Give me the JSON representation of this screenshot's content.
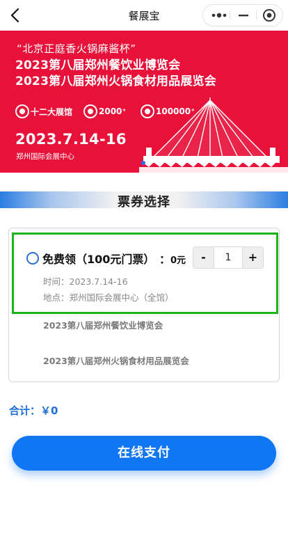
{
  "navbar": {
    "title": "餐展宝"
  },
  "banner": {
    "line1": "“北京正庭香火锅麻酱杯”",
    "line2": "2023第八届郑州餐饮业博览会",
    "line3": "2023第八届郑州火锅食材用品展览会",
    "badges": [
      {
        "label": "十二大展馆"
      },
      {
        "label": "2000⁺"
      },
      {
        "label": "100000⁺"
      }
    ],
    "date": "2023.7.14-16",
    "venue": "郑州国际会展中心",
    "colors": {
      "background": "#e8113a",
      "dot_active": "#2a6df4"
    }
  },
  "section": {
    "title": "票券选择"
  },
  "ticket": {
    "name": "免费领（100元门票）",
    "colon": "：",
    "price": "0元",
    "quantity": "1",
    "minus_label": "-",
    "plus_label": "+",
    "time_label": "时间：",
    "time_value": "2023.7.14-16",
    "place_label": "地点：",
    "place_value": "郑州国际会展中心（全馆）",
    "highlight_color": "#1db31d"
  },
  "exhibitions": [
    {
      "name": "2023第八届郑州餐饮业博览会"
    },
    {
      "name": "2023第八届郑州火锅食材用品展览会"
    }
  ],
  "summary": {
    "total_label": "合计：",
    "total_value": "￥0"
  },
  "actions": {
    "pay_label": "在线支付",
    "pay_color": "#1176f1"
  }
}
